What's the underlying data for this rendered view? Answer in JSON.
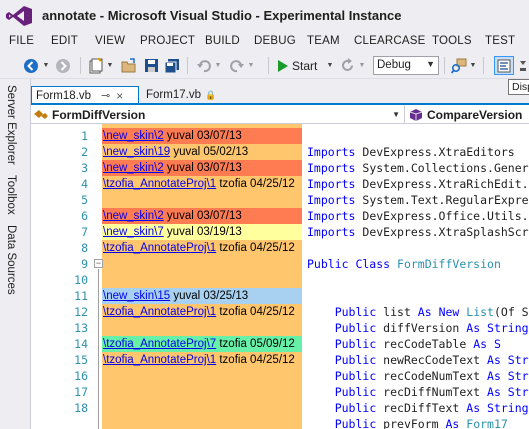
{
  "window": {
    "title": "annotate - Microsoft Visual Studio - Experimental Instance"
  },
  "menu": [
    "FILE",
    "EDIT",
    "VIEW",
    "PROJECT",
    "BUILD",
    "DEBUG",
    "TEAM",
    "CLEARCASE",
    "TOOLS",
    "TEST"
  ],
  "toolbar": {
    "start_label": "Start",
    "config_value": "Debug",
    "tooltip": "Disp"
  },
  "side_tabs": [
    "Server Explorer",
    "Toolbox",
    "Data Sources"
  ],
  "doc_tabs": [
    {
      "label": "Form18.vb",
      "pin": "⊸",
      "close": "×",
      "active": true
    },
    {
      "label": "Form17.vb",
      "lock": "🔒",
      "active": false
    }
  ],
  "navbar": {
    "left": "FormDiffVersion",
    "right": "CompareVersion"
  },
  "colors": {
    "accent": "#007acc",
    "ann_default": "#ffc66e",
    "ann_red": "#ff7b52",
    "ann_yellow": "#ffff9e",
    "ann_blue": "#a8d0f0",
    "ann_green": "#66f0a8"
  },
  "line_numbers": [
    "1",
    "2",
    "3",
    "4",
    "5",
    "6",
    "7",
    "8",
    "9",
    "10",
    "11",
    "12",
    "13",
    "14",
    "15",
    "16",
    "17",
    "18"
  ],
  "annotations": [
    {
      "line": 1,
      "link": "\\new_skin\\2",
      "rest": " yuval 03/07/13",
      "color": "ann_red"
    },
    {
      "line": 2,
      "link": "\\new_skin\\19",
      "rest": " yuval 05/02/13",
      "color": "ann_default"
    },
    {
      "line": 3,
      "link": "\\new_skin\\2",
      "rest": " yuval 03/07/13",
      "color": "ann_red"
    },
    {
      "line": 4,
      "link": "\\tzofia_AnnotateProj\\1",
      "rest": " tzofia 04/25/12",
      "color": "ann_default"
    },
    {
      "line": 6,
      "link": "\\new_skin\\2",
      "rest": " yuval 03/07/13",
      "color": "ann_red"
    },
    {
      "line": 7,
      "link": "\\new_skin\\7",
      "rest": " yuval 03/19/13",
      "color": "ann_yellow"
    },
    {
      "line": 8,
      "link": "\\tzofia_AnnotateProj\\1",
      "rest": " tzofia 04/25/12",
      "color": "ann_default"
    },
    {
      "line": 11,
      "link": "\\new_skin\\15",
      "rest": " yuval 03/25/13",
      "color": "ann_blue"
    },
    {
      "line": 12,
      "link": "\\tzofia_AnnotateProj\\1",
      "rest": " tzofia 04/25/12",
      "color": "ann_default"
    },
    {
      "line": 14,
      "link": "\\tzofia_AnnotateProj\\7",
      "rest": " tzofia 05/09/12",
      "color": "ann_green"
    },
    {
      "line": 15,
      "link": "\\tzofia_AnnotateProj\\1",
      "rest": " tzofia 04/25/12",
      "color": "ann_default"
    }
  ],
  "code": [
    {
      "line": 2,
      "parts": [
        [
          "kw",
          "Imports "
        ],
        [
          "tx",
          "DevExpress.XtraEditors"
        ]
      ]
    },
    {
      "line": 3,
      "parts": [
        [
          "kw",
          "Imports "
        ],
        [
          "tx",
          "System.Collections.Gener"
        ]
      ]
    },
    {
      "line": 4,
      "parts": [
        [
          "kw",
          "Imports "
        ],
        [
          "tx",
          "DevExpress.XtraRichEdit."
        ]
      ]
    },
    {
      "line": 5,
      "parts": [
        [
          "kw",
          "Imports "
        ],
        [
          "tx",
          "System.Text.RegularExpre"
        ]
      ]
    },
    {
      "line": 6,
      "parts": [
        [
          "kw",
          "Imports "
        ],
        [
          "tx",
          "DevExpress.Office.Utils."
        ]
      ]
    },
    {
      "line": 7,
      "parts": [
        [
          "kw",
          "Imports "
        ],
        [
          "tx",
          "DevExpress.XtraSplashScr"
        ]
      ]
    },
    {
      "line": 9,
      "parts": [
        [
          "kw",
          "Public Class "
        ],
        [
          "ty",
          "FormDiffVersion"
        ]
      ]
    },
    {
      "line": 12,
      "parts": [
        [
          "tx",
          "    "
        ],
        [
          "kw",
          "Public "
        ],
        [
          "tx",
          "list "
        ],
        [
          "kw",
          "As New "
        ],
        [
          "ty",
          "List"
        ],
        [
          "tx",
          "(Of S"
        ]
      ]
    },
    {
      "line": 13,
      "parts": [
        [
          "tx",
          "    "
        ],
        [
          "kw",
          "Public "
        ],
        [
          "tx",
          "diffVersion "
        ],
        [
          "kw",
          "As String"
        ]
      ]
    },
    {
      "line": 14,
      "parts": [
        [
          "tx",
          "    "
        ],
        [
          "kw",
          "Public "
        ],
        [
          "tx",
          "recCodeTable "
        ],
        [
          "kw",
          "As S"
        ]
      ]
    },
    {
      "line": 15,
      "parts": [
        [
          "tx",
          "    "
        ],
        [
          "kw",
          "Public "
        ],
        [
          "tx",
          "newRecCodeText "
        ],
        [
          "kw",
          "As Str"
        ]
      ]
    },
    {
      "line": 16,
      "parts": [
        [
          "tx",
          "    "
        ],
        [
          "kw",
          "Public "
        ],
        [
          "tx",
          "recCodeNumText "
        ],
        [
          "kw",
          "As Str"
        ]
      ]
    },
    {
      "line": 17,
      "parts": [
        [
          "tx",
          "    "
        ],
        [
          "kw",
          "Public "
        ],
        [
          "tx",
          "recDiffNumText "
        ],
        [
          "kw",
          "As Str"
        ]
      ]
    },
    {
      "line": 18,
      "parts": [
        [
          "tx",
          "    "
        ],
        [
          "kw",
          "Public "
        ],
        [
          "tx",
          "recDiffText "
        ],
        [
          "kw",
          "As String"
        ]
      ]
    },
    {
      "line": 19,
      "parts": [
        [
          "tx",
          "    "
        ],
        [
          "kw",
          "Public "
        ],
        [
          "tx",
          "prevForm "
        ],
        [
          "kw",
          "As "
        ],
        [
          "ty",
          "Form17"
        ]
      ]
    }
  ]
}
